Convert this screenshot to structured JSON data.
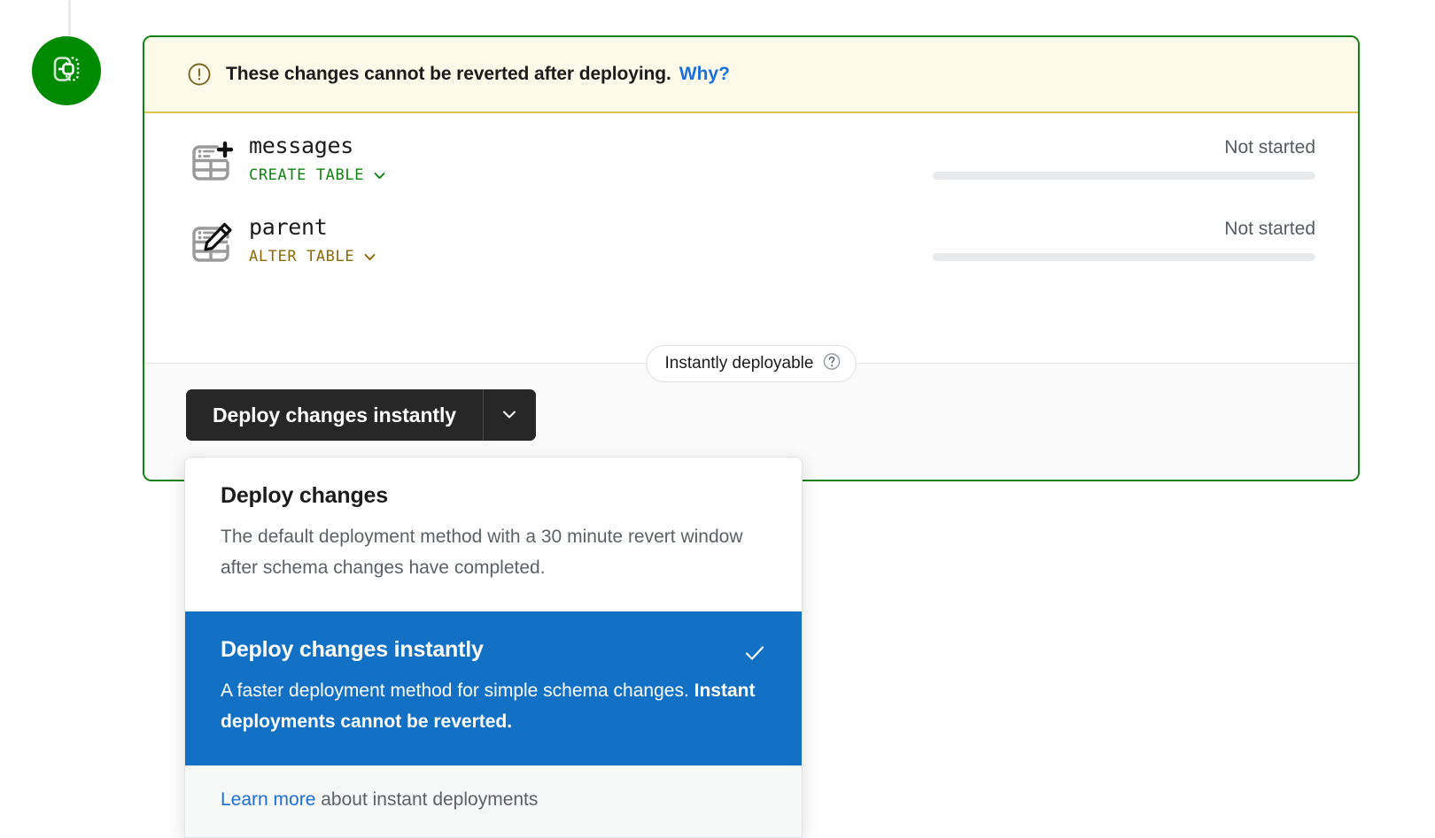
{
  "rail": {
    "badge_icon": "deployment-merge-icon",
    "badge_color": "#008a00"
  },
  "card": {
    "border_color": "#128312",
    "warning": {
      "icon": "alert-circle-icon",
      "text": "These changes cannot be reverted after deploying.",
      "link_label": "Why?",
      "link_color": "#1a6fdb",
      "background": "#fdfaea",
      "border_color": "#e0c44a"
    },
    "changes": [
      {
        "icon": "table-add-icon",
        "name": "messages",
        "operation": "CREATE TABLE",
        "operation_color": "#128312",
        "chevron": "chevron-down-icon",
        "status": "Not started",
        "progress": 0
      },
      {
        "icon": "table-edit-icon",
        "name": "parent",
        "operation": "ALTER TABLE",
        "operation_color": "#8a6a09",
        "chevron": "chevron-down-icon",
        "status": "Not started",
        "progress": 0
      }
    ],
    "footer": {
      "badge_label": "Instantly deployable",
      "badge_help_icon": "question-circle-icon",
      "deploy_button_label": "Deploy changes instantly",
      "deploy_caret_icon": "chevron-down-icon"
    }
  },
  "dropdown": {
    "items": [
      {
        "title": "Deploy changes",
        "description": "The default deployment method with a 30 minute revert window after schema changes have completed.",
        "selected": false
      },
      {
        "title": "Deploy changes instantly",
        "description_lead": "A faster deployment method for simple schema changes. ",
        "description_emph": "Instant deployments cannot be reverted.",
        "selected": true,
        "check_icon": "check-icon",
        "highlight_color": "#1271c4"
      }
    ],
    "footer": {
      "link_label": "Learn more",
      "rest": " about instant deployments"
    }
  }
}
